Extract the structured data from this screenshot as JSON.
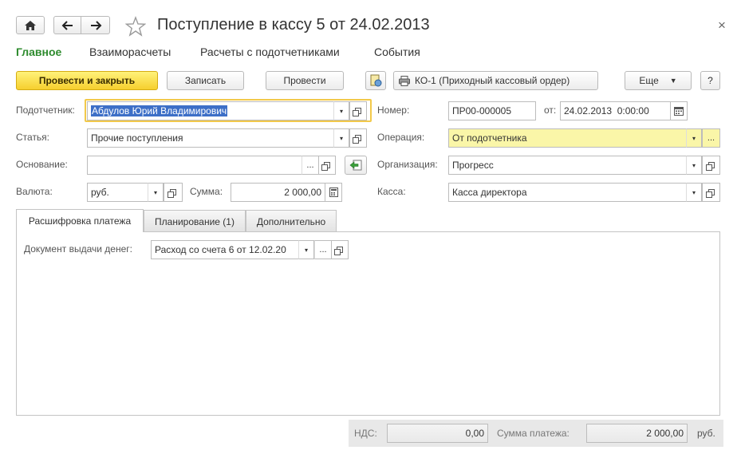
{
  "window": {
    "title": "Поступление в кассу 5 от 24.02.2013",
    "close_glyph": "×"
  },
  "nav": {
    "items": [
      "Главное",
      "Взаиморасчеты",
      "Расчеты с подотчетниками",
      "События"
    ]
  },
  "toolbar": {
    "post_close": "Провести и закрыть",
    "save": "Записать",
    "post": "Провести",
    "print_form": "КО-1 (Приходный кассовый ордер)",
    "more": "Еще",
    "help": "?"
  },
  "form": {
    "accountable_label": "Подотчетник:",
    "accountable_value": "Абдулов Юрий Владимирович",
    "article_label": "Статья:",
    "article_value": "Прочие поступления",
    "basis_label": "Основание:",
    "basis_value": "",
    "currency_label": "Валюта:",
    "currency_value": "руб.",
    "sum_label": "Сумма:",
    "sum_value": "2 000,00",
    "number_label": "Номер:",
    "number_value": "ПР00-000005",
    "date_label": "от:",
    "date_value": "24.02.2013  0:00:00",
    "operation_label": "Операция:",
    "operation_value": "От подотчетника",
    "org_label": "Организация:",
    "org_value": "Прогресс",
    "cashbox_label": "Касса:",
    "cashbox_value": "Касса директора"
  },
  "tabs": {
    "items": [
      "Расшифровка платежа",
      "Планирование (1)",
      "Дополнительно"
    ]
  },
  "tab_content": {
    "doc_label": "Документ выдачи денег:",
    "doc_value": "Расход со счета 6 от 12.02.20"
  },
  "footer": {
    "vat_label": "НДС:",
    "vat_value": "0,00",
    "payment_label": "Сумма платежа:",
    "payment_value": "2 000,00",
    "currency": "руб."
  },
  "colors": {
    "accent_green": "#2e8b2e",
    "primary_yellow": "#f6cf2e",
    "field_highlight": "#faf6a8"
  }
}
